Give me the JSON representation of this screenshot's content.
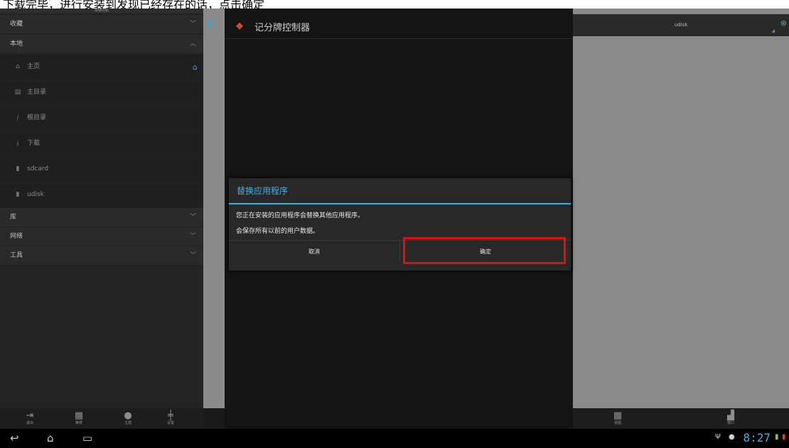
{
  "caption": {
    "text": "下载完毕，进行安装到发现已经存在的话，点击确定"
  },
  "nav": {
    "header": "快捷导航",
    "groups": {
      "favorites": "收藏",
      "local": "本地",
      "library": "库",
      "network": "网络",
      "tools": "工具"
    },
    "items": [
      {
        "label": "主页",
        "icon": "home-icon"
      },
      {
        "label": "主目录",
        "icon": "folder-icon"
      },
      {
        "label": "根目录",
        "icon": "slash-icon"
      },
      {
        "label": "下载",
        "icon": "download-icon"
      },
      {
        "label": "sdcard",
        "icon": "sdcard-icon"
      },
      {
        "label": "udisk",
        "icon": "udisk-icon"
      }
    ],
    "bottom_buttons": [
      {
        "label": "退出",
        "icon": "exit-icon"
      },
      {
        "label": "推荐",
        "icon": "gift-icon"
      },
      {
        "label": "主题",
        "icon": "theme-icon"
      },
      {
        "label": "设置",
        "icon": "settings-icon"
      }
    ]
  },
  "app": {
    "title": "记分牌控制器"
  },
  "dialog": {
    "title": "替换应用程序",
    "message_line1": "您正在安装的应用程序会替换其他应用程序。",
    "message_line2": "会保存所有以前的用户数据。",
    "cancel_label": "取消",
    "ok_label": "确定",
    "highlight_color": "#e01010",
    "accent_color": "#33b5e5"
  },
  "right_panel": {
    "title": "udisk",
    "bottom_buttons": [
      {
        "label": "视图",
        "icon": "grid-icon"
      },
      {
        "label": "窗口",
        "icon": "window-icon"
      }
    ]
  },
  "system_bar": {
    "time": "8:27"
  }
}
